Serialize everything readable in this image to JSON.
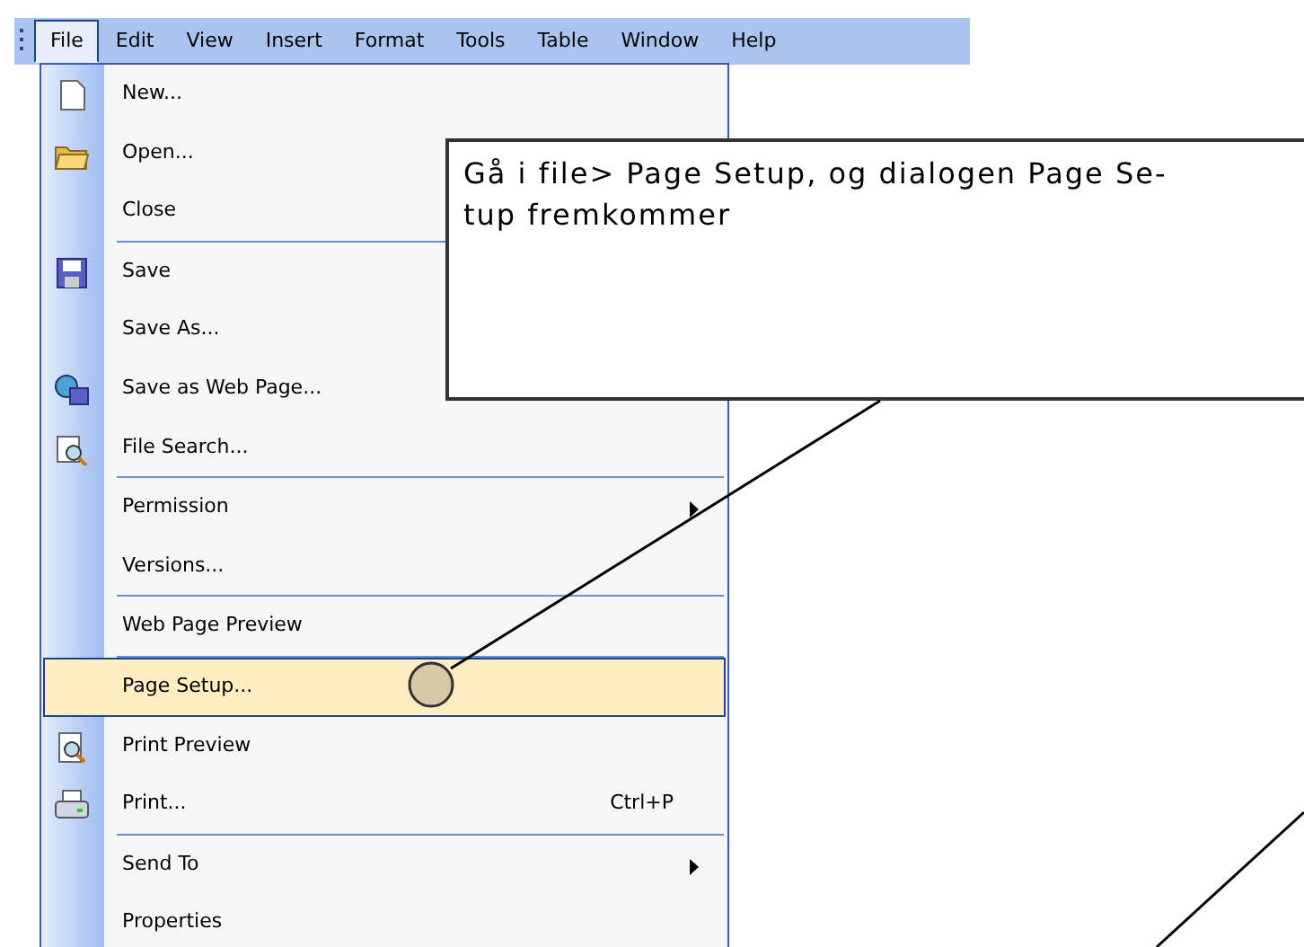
{
  "menubar": [
    {
      "label": "File",
      "selected": true
    },
    {
      "label": "Edit",
      "selected": false
    },
    {
      "label": "View",
      "selected": false
    },
    {
      "label": "Insert",
      "selected": false
    },
    {
      "label": "Format",
      "selected": false
    },
    {
      "label": "Tools",
      "selected": false
    },
    {
      "label": "Table",
      "selected": false
    },
    {
      "label": "Window",
      "selected": false
    },
    {
      "label": "Help",
      "selected": false
    }
  ],
  "file_menu": [
    {
      "kind": "item",
      "label": "New...",
      "selected": false
    },
    {
      "kind": "item",
      "label": "Open...",
      "selected": false
    },
    {
      "kind": "item",
      "label": "Close",
      "selected": false
    },
    {
      "kind": "separator"
    },
    {
      "kind": "item",
      "label": "Save",
      "selected": false
    },
    {
      "kind": "item",
      "label": "Save As...",
      "selected": false
    },
    {
      "kind": "item",
      "label": "Save as Web Page...",
      "selected": false
    },
    {
      "kind": "item",
      "label": "File Search...",
      "selected": false
    },
    {
      "kind": "separator"
    },
    {
      "kind": "item",
      "label": "Permission",
      "selected": false,
      "submenu": true
    },
    {
      "kind": "item",
      "label": "Versions...",
      "selected": false
    },
    {
      "kind": "separator"
    },
    {
      "kind": "item",
      "label": "Web Page Preview",
      "selected": false
    },
    {
      "kind": "separator"
    },
    {
      "kind": "item",
      "label": "Page Setup...",
      "selected": true
    },
    {
      "kind": "item",
      "label": "Print Preview",
      "selected": false
    },
    {
      "kind": "item",
      "label": "Print...",
      "selected": false,
      "shortcut": "Ctrl+P"
    },
    {
      "kind": "separator"
    },
    {
      "kind": "item",
      "label": "Send To",
      "selected": false,
      "submenu": true
    },
    {
      "kind": "item",
      "label": "Properties",
      "selected": false
    }
  ],
  "callout": {
    "text": "Gå i file> Page Setup, og dialogen Page Se-tup fremkommer"
  }
}
